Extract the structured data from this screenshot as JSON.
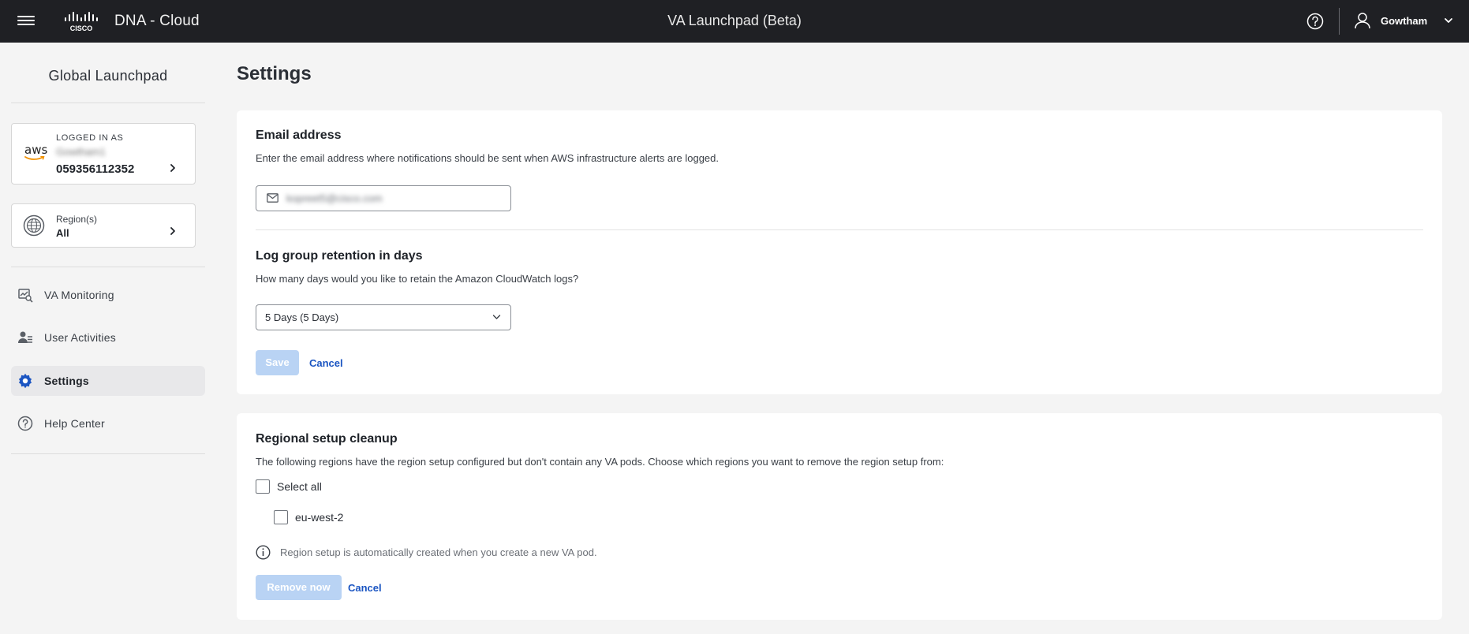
{
  "topbar": {
    "app_title": "DNA - Cloud",
    "center_title": "VA Launchpad (Beta)",
    "user_name": "Gowtham"
  },
  "sidebar": {
    "title": "Global Launchpad",
    "account": {
      "provider": "aws",
      "label": "LOGGED IN AS",
      "name": "Gowtham1",
      "account_id": "059356112352"
    },
    "region": {
      "label": "Region(s)",
      "value": "All"
    },
    "nav": [
      {
        "label": "VA Monitoring",
        "icon": "monitoring-icon",
        "active": false
      },
      {
        "label": "User Activities",
        "icon": "user-activities-icon",
        "active": false
      },
      {
        "label": "Settings",
        "icon": "gear-icon",
        "active": true
      },
      {
        "label": "Help Center",
        "icon": "help-icon",
        "active": false
      }
    ]
  },
  "main": {
    "page_title": "Settings",
    "email": {
      "title": "Email address",
      "description": "Enter the email address where notifications should be sent when AWS infrastructure alerts are logged.",
      "value": "kopreet5@cisco.com"
    },
    "retention": {
      "title": "Log group retention in days",
      "description": "How many days would you like to retain the Amazon CloudWatch logs?",
      "selected": "5 Days (5 Days)"
    },
    "actions": {
      "save_label": "Save",
      "cancel_label": "Cancel"
    },
    "cleanup": {
      "title": "Regional setup cleanup",
      "description": "The following regions have the region setup configured but don't contain any VA pods. Choose which regions you want to remove the region setup from:",
      "select_all_label": "Select all",
      "regions": [
        "eu-west-2"
      ],
      "info": "Region setup is automatically created when you create a new VA pod.",
      "remove_label": "Remove now",
      "cancel_label": "Cancel"
    }
  },
  "colors": {
    "topbar_bg": "#1f2024",
    "accent": "#1b55c2",
    "disabled_button": "#b9d3f4",
    "page_bg": "#f4f4f4"
  }
}
